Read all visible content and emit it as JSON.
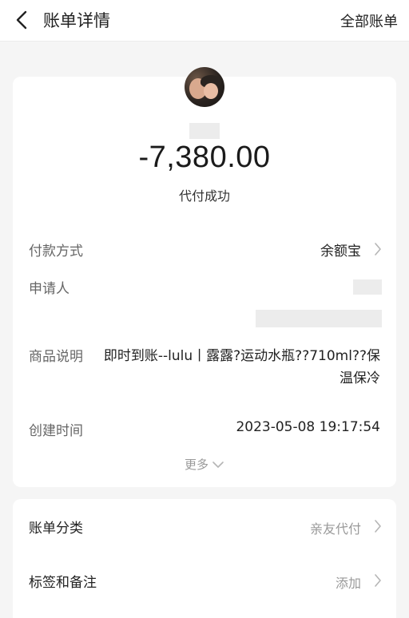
{
  "header": {
    "title": "账单详情",
    "right_link": "全部账单"
  },
  "summary": {
    "amount": "-7,380.00",
    "status": "代付成功"
  },
  "details": {
    "payment_method_label": "付款方式",
    "payment_method_value": "余额宝",
    "applicant_label": "申请人",
    "product_desc_label": "商品说明",
    "product_desc_value": "即时到账--lulu丨露露?运动水瓶??710ml??保温保冷",
    "created_time_label": "创建时间",
    "created_time_value": "2023-05-08 19:17:54",
    "more_label": "更多"
  },
  "bill_meta": {
    "category_label": "账单分类",
    "category_value": "亲友代付",
    "tags_label": "标签和备注",
    "tags_value": "添加"
  },
  "icons": {
    "back": "chevron-left-icon",
    "row_arrow": "chevron-right-icon",
    "more_arrow": "chevron-down-icon"
  },
  "colors": {
    "background": "#f5f5f5",
    "card": "#ffffff",
    "muted_text": "#999999",
    "label_text": "#666666"
  }
}
